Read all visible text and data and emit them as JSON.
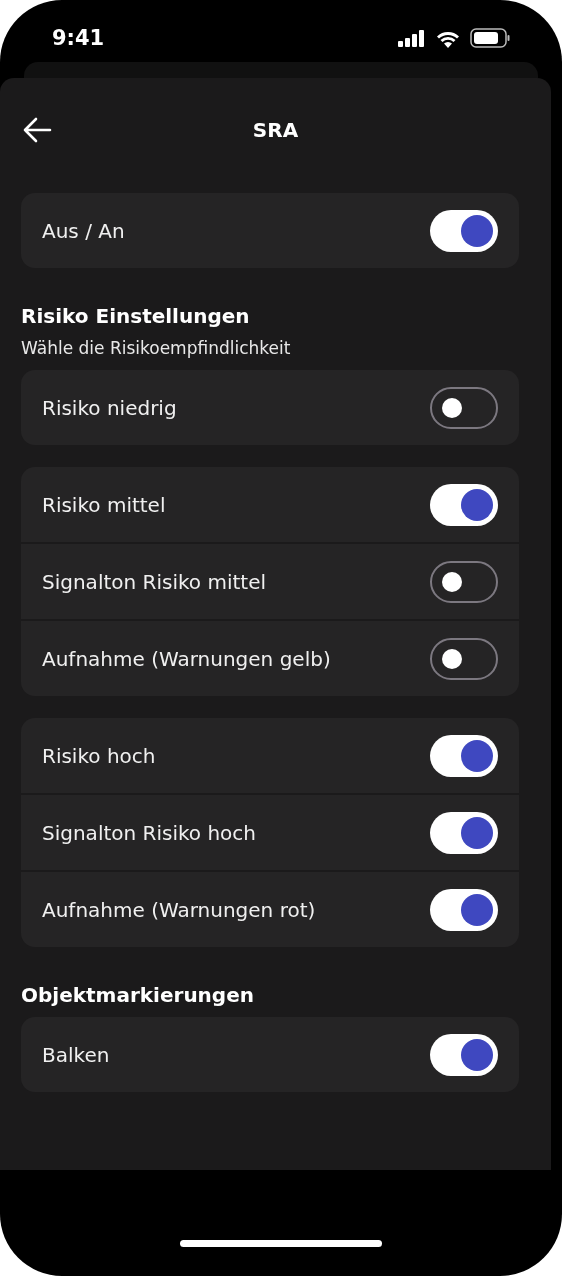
{
  "status_bar": {
    "time": "9:41"
  },
  "header": {
    "title": "SRA"
  },
  "sections": [
    {
      "groups": [
        {
          "rows": [
            {
              "label": "Aus / An",
              "on": true
            }
          ]
        }
      ]
    },
    {
      "title": "Risiko Einstellungen",
      "subtitle": "Wähle die Risikoempfindlichkeit",
      "groups": [
        {
          "rows": [
            {
              "label": "Risiko niedrig",
              "on": false
            }
          ]
        },
        {
          "rows": [
            {
              "label": "Risiko mittel",
              "on": true
            },
            {
              "label": "Signalton Risiko mittel",
              "on": false
            },
            {
              "label": "Aufnahme (Warnungen gelb)",
              "on": false
            }
          ]
        },
        {
          "rows": [
            {
              "label": "Risiko hoch",
              "on": true
            },
            {
              "label": "Signalton Risiko hoch",
              "on": true
            },
            {
              "label": "Aufnahme (Warnungen rot)",
              "on": true
            }
          ]
        }
      ]
    },
    {
      "title": "Objektmarkierungen",
      "groups": [
        {
          "rows": [
            {
              "label": "Balken",
              "on": true
            }
          ]
        }
      ]
    }
  ]
}
